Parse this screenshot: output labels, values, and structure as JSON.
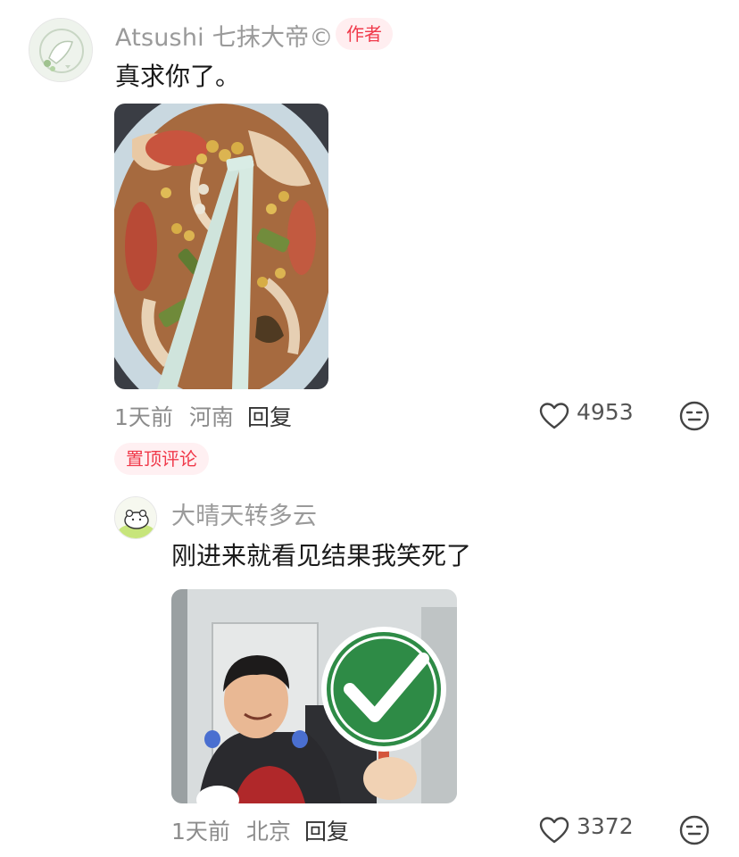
{
  "top_comment": {
    "username": "Atsushi 七抹大帝©",
    "author_badge": "作者",
    "text": "真求你了。",
    "time": "1天前",
    "location": "河南",
    "reply_label": "回复",
    "like_count": "4953",
    "pinned_label": "置顶评论",
    "image_icon": "food-photo",
    "like_icon": "heart-outline-icon",
    "react_icon": "neutral-face-icon"
  },
  "reply_comment": {
    "username": "大晴天转多云",
    "text": "刚进来就看见结果我笑死了",
    "time": "1天前",
    "location": "北京",
    "reply_label": "回复",
    "like_count": "3372",
    "image_icon": "meme-photo-checkmark-sign",
    "like_icon": "heart-outline-icon",
    "react_icon": "neutral-face-icon"
  },
  "colors": {
    "badge_red": "#f03a4b",
    "meta_gray": "#8c8c8c",
    "username_gray": "#9a9a9a"
  }
}
